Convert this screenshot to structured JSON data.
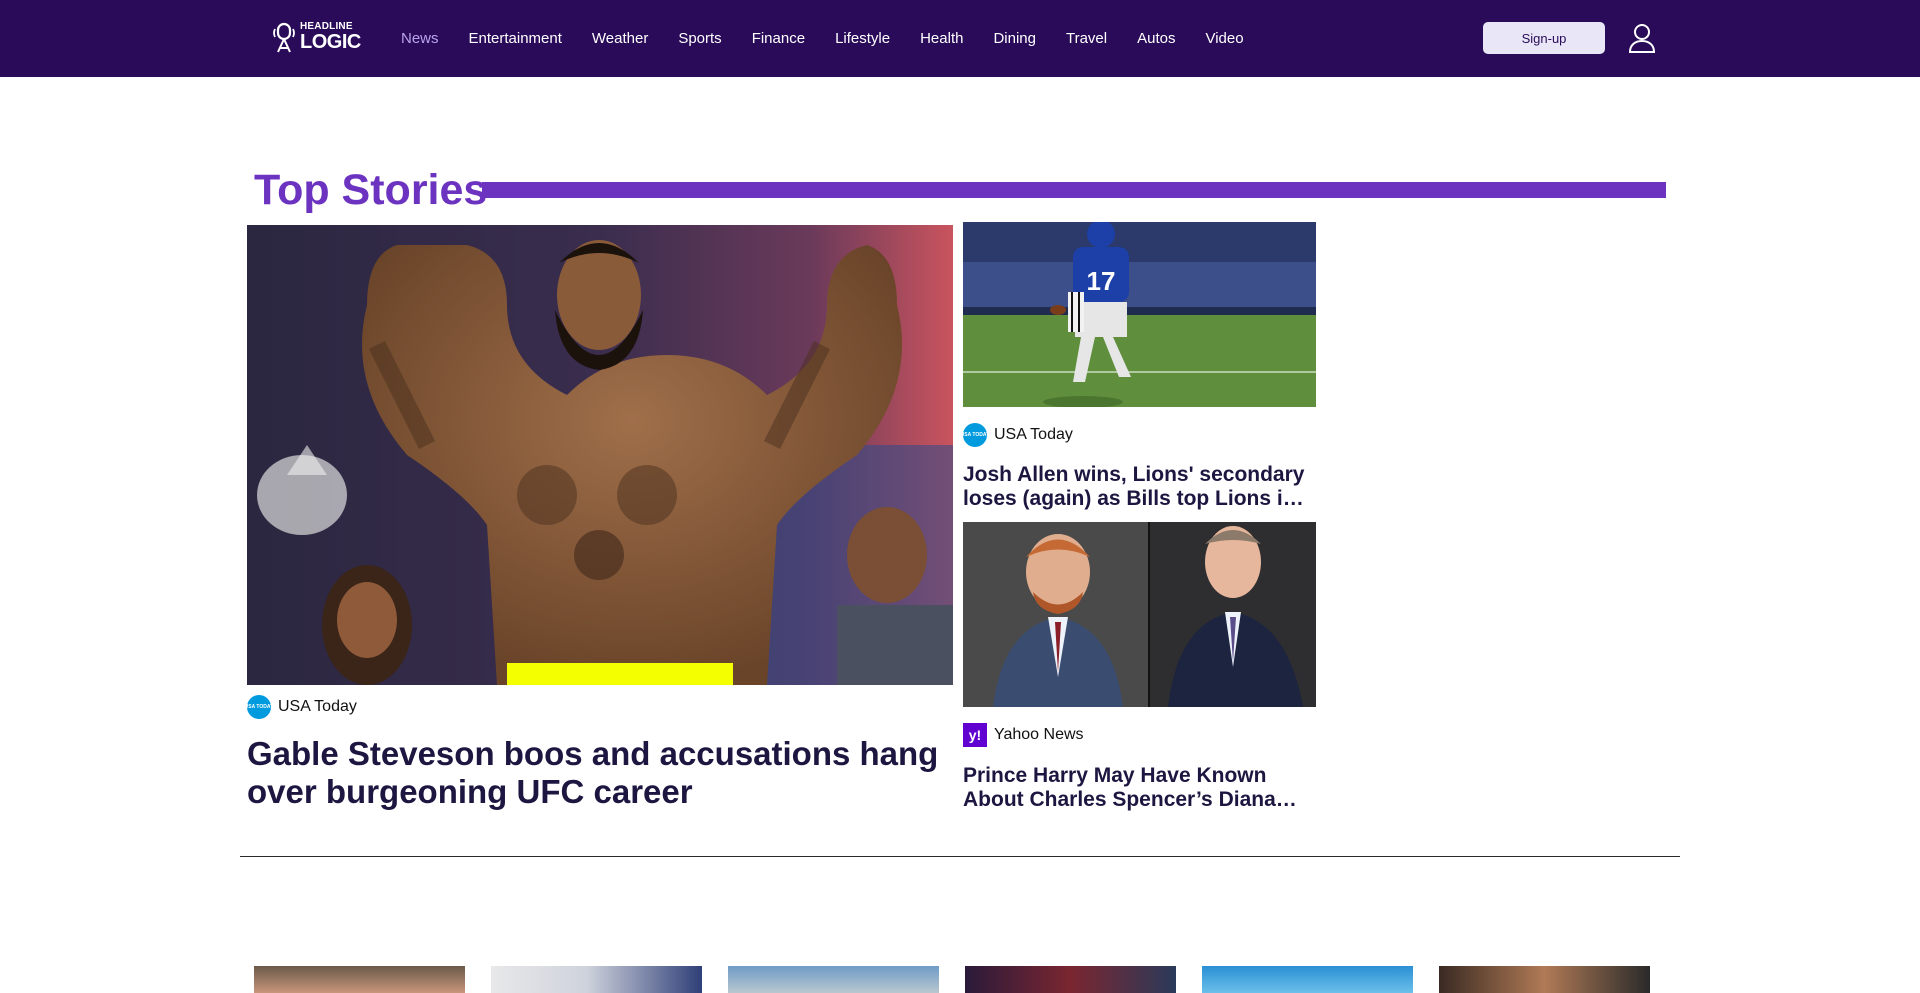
{
  "brand": {
    "logo_top": "HEADLINE",
    "logo_bottom": "LOGIC",
    "primary_color": "#2a0b5a",
    "accent_color": "#6b33bf"
  },
  "nav": {
    "items": [
      {
        "label": "News",
        "active": true
      },
      {
        "label": "Entertainment"
      },
      {
        "label": "Weather"
      },
      {
        "label": "Sports"
      },
      {
        "label": "Finance"
      },
      {
        "label": "Lifestyle"
      },
      {
        "label": "Health"
      },
      {
        "label": "Dining"
      },
      {
        "label": "Travel"
      },
      {
        "label": "Autos"
      },
      {
        "label": "Video"
      }
    ],
    "signup_label": "Sign-up",
    "user_icon": "user-icon"
  },
  "top_stories": {
    "title": "Top Stories",
    "main": {
      "source": "USA Today",
      "source_badge": "USA TODAY",
      "headline": "Gable Steveson boos and accusations hang over burgeoning UFC career"
    },
    "side": [
      {
        "source": "USA Today",
        "source_badge": "USA TODAY",
        "headline": "Josh Allen wins, Lions' secondary loses (again) as Bills top Lions in Sunday night showdown"
      },
      {
        "source": "Yahoo News",
        "source_badge": "y!",
        "headline": "Prince Harry May Have Known About Charles Spencer’s Diana secret, royal expert claims"
      }
    ]
  }
}
